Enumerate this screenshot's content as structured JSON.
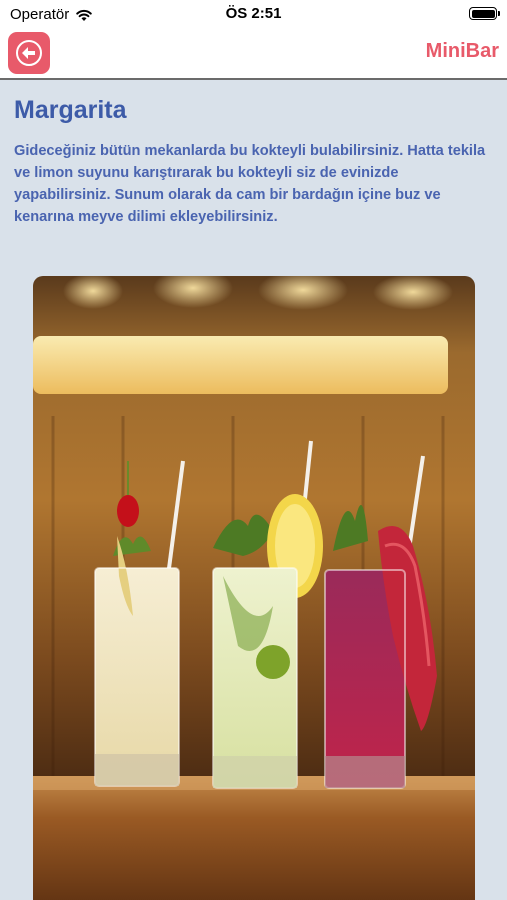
{
  "status_bar": {
    "carrier": "Operatör",
    "time": "ÖS 2:51"
  },
  "nav": {
    "back_icon": "arrow-left-circle-icon",
    "brand": "MiniBar"
  },
  "cocktail": {
    "name": "Margarita",
    "description": "Gideceğiniz bütün mekanlarda bu kokteyli bulabilirsiniz. Hatta tekila ve limon suyunu karıştırarak bu kokteyli siz de evinizde yapabilirsiniz. Sunum olarak da cam bir bardağın içine buz ve kenarına meyve dilimi ekleyebilirsiniz."
  },
  "colors": {
    "accent": "#e85a6a",
    "title": "#3d5ba8",
    "background": "#d9e1ea"
  }
}
